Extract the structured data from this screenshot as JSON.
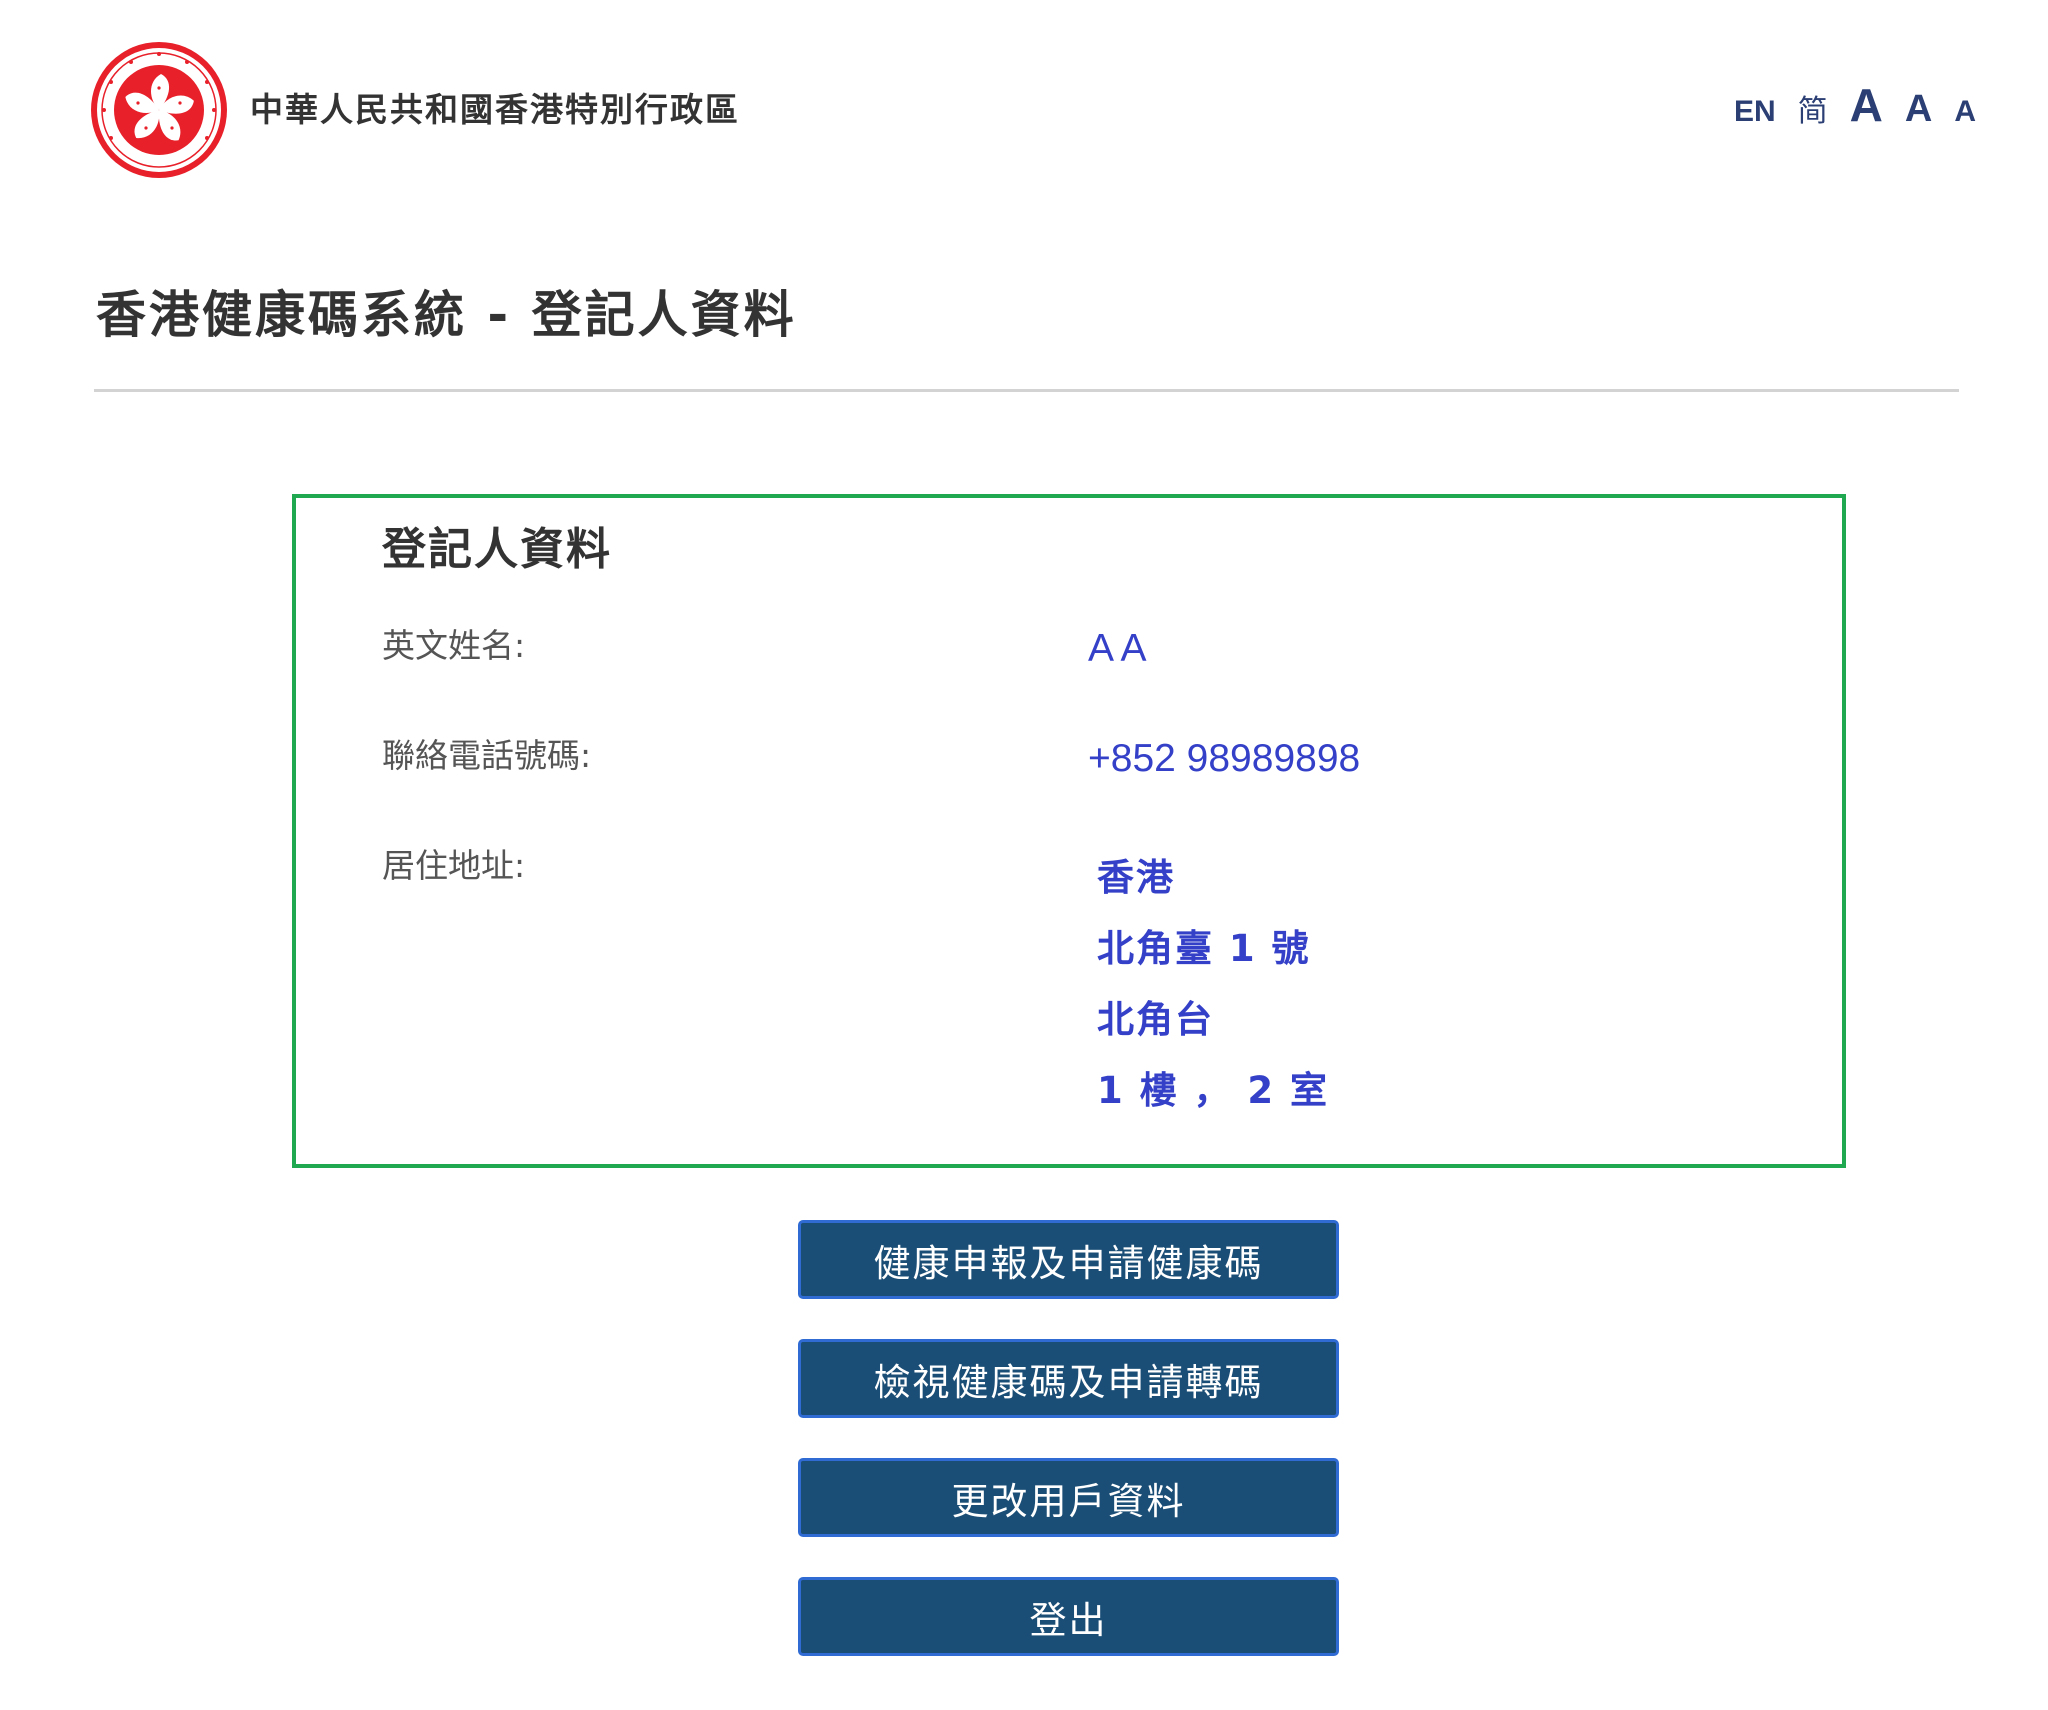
{
  "header": {
    "gov_name": "中華人民共和國香港特別行政區",
    "emblem_icon": "hksar-regional-emblem-icon",
    "language_links": {
      "english": "EN",
      "simplified_chinese": "简"
    },
    "font_size_controls": {
      "large": "A",
      "medium": "A",
      "small": "A"
    }
  },
  "page": {
    "title": "香港健康碼系統 - 登記人資料"
  },
  "registrant": {
    "section_title": "登記人資料",
    "fields": {
      "english_name": {
        "label": "英文姓名:",
        "value": "A A"
      },
      "phone": {
        "label": "聯絡電話號碼:",
        "value": "+852 98989898"
      },
      "address": {
        "label": "居住地址:",
        "lines": [
          "香港",
          "北角臺 1 號",
          "北角台",
          " 1 樓 ， 2 室"
        ]
      }
    }
  },
  "actions": {
    "health_declaration": "健康申報及申請健康碼",
    "view_code_transfer": "檢視健康碼及申請轉碼",
    "edit_user_info": "更改用戶資料",
    "logout": "登出"
  },
  "colors": {
    "card_border": "#1fa84f",
    "value_text": "#3440c8",
    "button_bg": "#1b4e76",
    "button_border": "#2f6bd3",
    "lang_link": "#2b3f74"
  }
}
